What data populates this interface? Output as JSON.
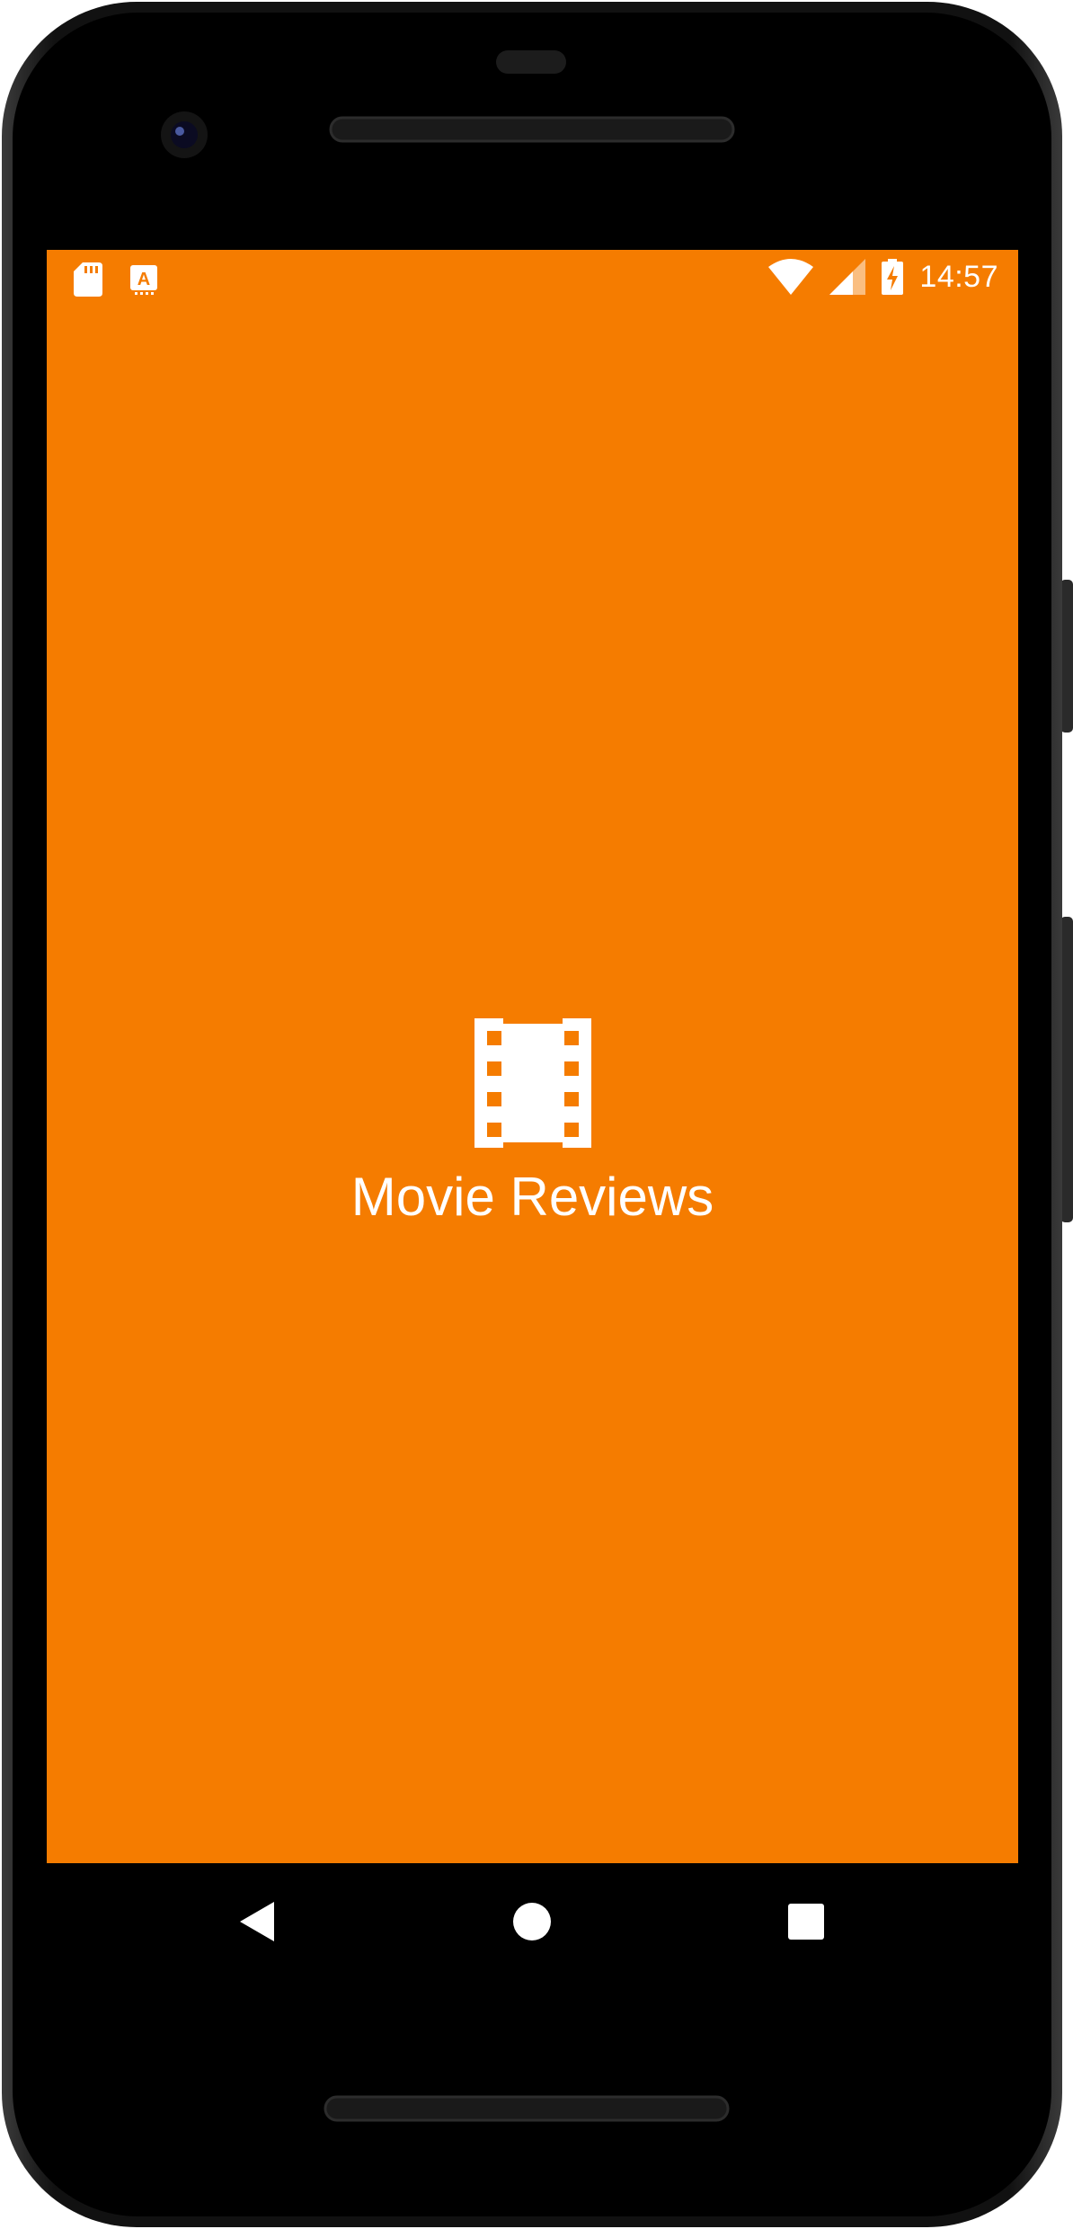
{
  "app": {
    "title": "Movie Reviews",
    "background_color": "#F57C00",
    "icon": "movie-film-icon"
  },
  "status_bar": {
    "time": "14:57",
    "left_icons": [
      "sd-card-icon",
      "keyboard-a-icon"
    ],
    "right_icons": [
      "wifi-icon",
      "cellular-signal-icon",
      "battery-charging-icon"
    ]
  },
  "navigation_bar": {
    "buttons": [
      "back-icon",
      "home-icon",
      "recents-icon"
    ]
  }
}
